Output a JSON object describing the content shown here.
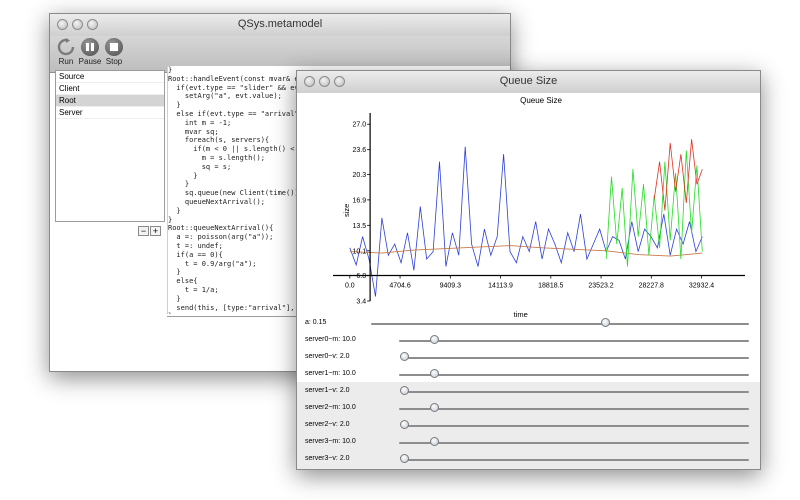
{
  "main_window": {
    "title": "QSys.metamodel",
    "toolbar": {
      "run_label": "Run",
      "pause_label": "Pause",
      "stop_label": "Stop"
    },
    "list_items": [
      "Source",
      "Client",
      "Root",
      "Server"
    ],
    "selected_item": "Root",
    "add_label": "+",
    "remove_label": "−",
    "code_lines": [
      "}",
      "",
      "Root::handleEvent(const mvar& evt){",
      "  if(evt.type == \"slider\" && evt.",
      "    setArg(\"a\", evt.value);",
      "  }",
      "  else if(evt.type == \"arrival\"){",
      "    int m = -1;",
      "    mvar sq;",
      "    foreach(s, servers){",
      "      if(m < 0 || s.length() < m",
      "        m = s.length();",
      "        sq = s;",
      "      }",
      "    }",
      "    sq.queue(new Client(time()));",
      "    queueNextArrival();",
      "  }",
      "}",
      "",
      "Root::queueNextArrival(){",
      "  a =: poisson(arg(\"a\"));",
      "  t =: undef;",
      "  if(a == 0){",
      "    t = 0.9/arg(\"a\");",
      "  }",
      "  else{",
      "    t = 1/a;",
      "  }",
      "  send(this, [type:\"arrival\"], t",
      "}"
    ]
  },
  "queue_window": {
    "title": "Queue Size",
    "sliders": [
      {
        "label": "a: 0.15",
        "value": 0.62
      },
      {
        "label": "server0~m: 10.0",
        "value": 0.1
      },
      {
        "label": "server0~v: 2.0",
        "value": 0.01
      },
      {
        "label": "server1~m: 10.0",
        "value": 0.1
      },
      {
        "label": "server1~v: 2.0",
        "value": 0.01
      },
      {
        "label": "server2~m: 10.0",
        "value": 0.1
      },
      {
        "label": "server2~v: 2.0",
        "value": 0.01
      },
      {
        "label": "server3~m: 10.0",
        "value": 0.1
      },
      {
        "label": "server3~v: 2.0",
        "value": 0.01
      }
    ]
  },
  "chart_data": {
    "type": "line",
    "title": "Queue Size",
    "xlabel": "time",
    "ylabel": "size",
    "xlim": [
      -1200,
      37000
    ],
    "ylim": [
      3.4,
      28.5
    ],
    "x_axis_at_y": 6.8,
    "x_ticks": [
      0.0,
      4704.6,
      9409.3,
      14113.9,
      18818.5,
      23523.2,
      28227.8,
      32932.4
    ],
    "x_tick_labels": [
      "0.0",
      "4704.6",
      "9409.3",
      "14113.9",
      "18818.5",
      "23523.2",
      "28227.8",
      "32932.4"
    ],
    "y_ticks": [
      3.4,
      6.8,
      10.1,
      13.5,
      16.9,
      20.3,
      23.6,
      27.0
    ],
    "y_tick_labels": [
      "3.4",
      "6.8",
      "10.1",
      "13.5",
      "16.9",
      "20.3",
      "23.6",
      "27.0"
    ],
    "series": [
      {
        "color": "#2b3fd6",
        "x": [
          0,
          600,
          1200,
          1800,
          2400,
          3000,
          3600,
          4200,
          4800,
          5400,
          6000,
          6600,
          7200,
          7800,
          8400,
          9000,
          9600,
          10200,
          10800,
          11400,
          12000,
          12600,
          13200,
          13800,
          14400,
          15000,
          15600,
          16200,
          16800,
          17400,
          18000,
          18600,
          19200,
          19800,
          20400,
          21000,
          21600,
          22200,
          22800,
          23400,
          24000,
          24600,
          25200,
          25800,
          26400,
          27000,
          27600,
          28200,
          28800,
          29400,
          30000,
          30600,
          31200,
          31800,
          32400,
          33000
        ],
        "y": [
          10.5,
          8.2,
          12.0,
          9.0,
          4.0,
          14.5,
          9.5,
          11.0,
          8.5,
          12.5,
          7.5,
          16.0,
          9.0,
          10.0,
          22.0,
          8.0,
          12.5,
          9.5,
          24.0,
          11.0,
          8.0,
          13.0,
          9.5,
          12.0,
          23.0,
          10.0,
          8.5,
          12.0,
          10.0,
          14.0,
          9.0,
          13.0,
          11.0,
          8.5,
          12.5,
          10.0,
          15.0,
          9.0,
          11.0,
          13.0,
          10.0,
          12.0,
          11.5,
          9.0,
          14.0,
          10.0,
          13.0,
          12.0,
          10.5,
          15.0,
          9.5,
          13.0,
          11.0,
          14.0,
          10.0,
          12.0
        ]
      },
      {
        "color": "#c87a4a",
        "x": [
          0,
          3000,
          6000,
          9000,
          12000,
          15000,
          18000,
          21000,
          24000,
          27000,
          30000,
          33000
        ],
        "y": [
          10.0,
          9.8,
          10.2,
          10.4,
          10.6,
          10.8,
          10.5,
          10.3,
          10.1,
          9.6,
          9.4,
          9.8
        ]
      },
      {
        "color": "#22dd22",
        "x": [
          24000,
          24500,
          25000,
          25500,
          26000,
          26500,
          27000,
          27500,
          28000,
          28500,
          29000,
          29500,
          30000,
          30500,
          31000,
          31500,
          32000,
          32500,
          33000
        ],
        "y": [
          9.0,
          20.0,
          11.0,
          18.5,
          8.0,
          21.0,
          12.0,
          19.0,
          9.5,
          17.5,
          10.5,
          22.0,
          11.5,
          20.5,
          9.0,
          23.5,
          12.5,
          21.5,
          10.0
        ]
      },
      {
        "color": "#e03020",
        "x": [
          28500,
          29000,
          29500,
          30000,
          30500,
          31000,
          31500,
          32000,
          32500,
          33000
        ],
        "y": [
          17.0,
          22.0,
          15.5,
          24.5,
          18.0,
          23.0,
          16.5,
          25.0,
          19.0,
          21.0
        ]
      }
    ]
  }
}
